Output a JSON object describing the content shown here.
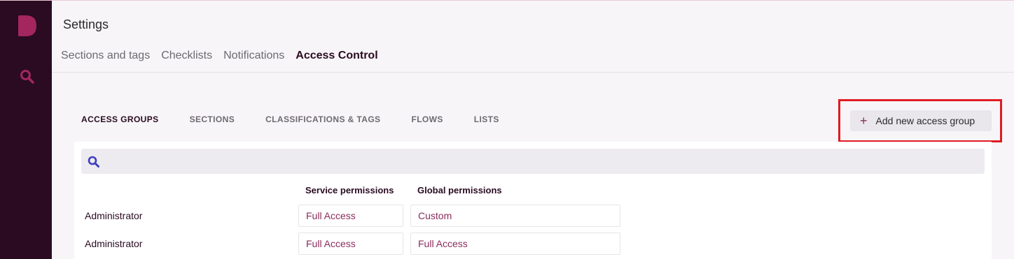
{
  "header": {
    "title": "Settings"
  },
  "top_tabs": [
    {
      "label": "Sections and tags"
    },
    {
      "label": "Checklists"
    },
    {
      "label": "Notifications"
    },
    {
      "label": "Access Control"
    }
  ],
  "active_top_tab": "Access Control",
  "sub_tabs": [
    {
      "label": "ACCESS GROUPS"
    },
    {
      "label": "SECTIONS"
    },
    {
      "label": "CLASSIFICATIONS & TAGS"
    },
    {
      "label": "FLOWS"
    },
    {
      "label": "LISTS"
    }
  ],
  "active_sub_tab": "ACCESS GROUPS",
  "add_button": {
    "label": "Add new access group",
    "icon": "plus-icon"
  },
  "search": {
    "value": "",
    "placeholder": ""
  },
  "table": {
    "columns": [
      "Service permissions",
      "Global permissions"
    ],
    "rows": [
      {
        "name": "Administrator",
        "service": "Full Access",
        "global": "Custom"
      },
      {
        "name": "Administrator",
        "service": "Full Access",
        "global": "Full Access"
      }
    ]
  },
  "colors": {
    "sidebar": "#2a0b21",
    "accent": "#8b2c5c",
    "highlight": "#e01b23",
    "search_icon": "#3d3fbf"
  },
  "icons": [
    "logo-icon",
    "search-icon",
    "plus-icon"
  ]
}
